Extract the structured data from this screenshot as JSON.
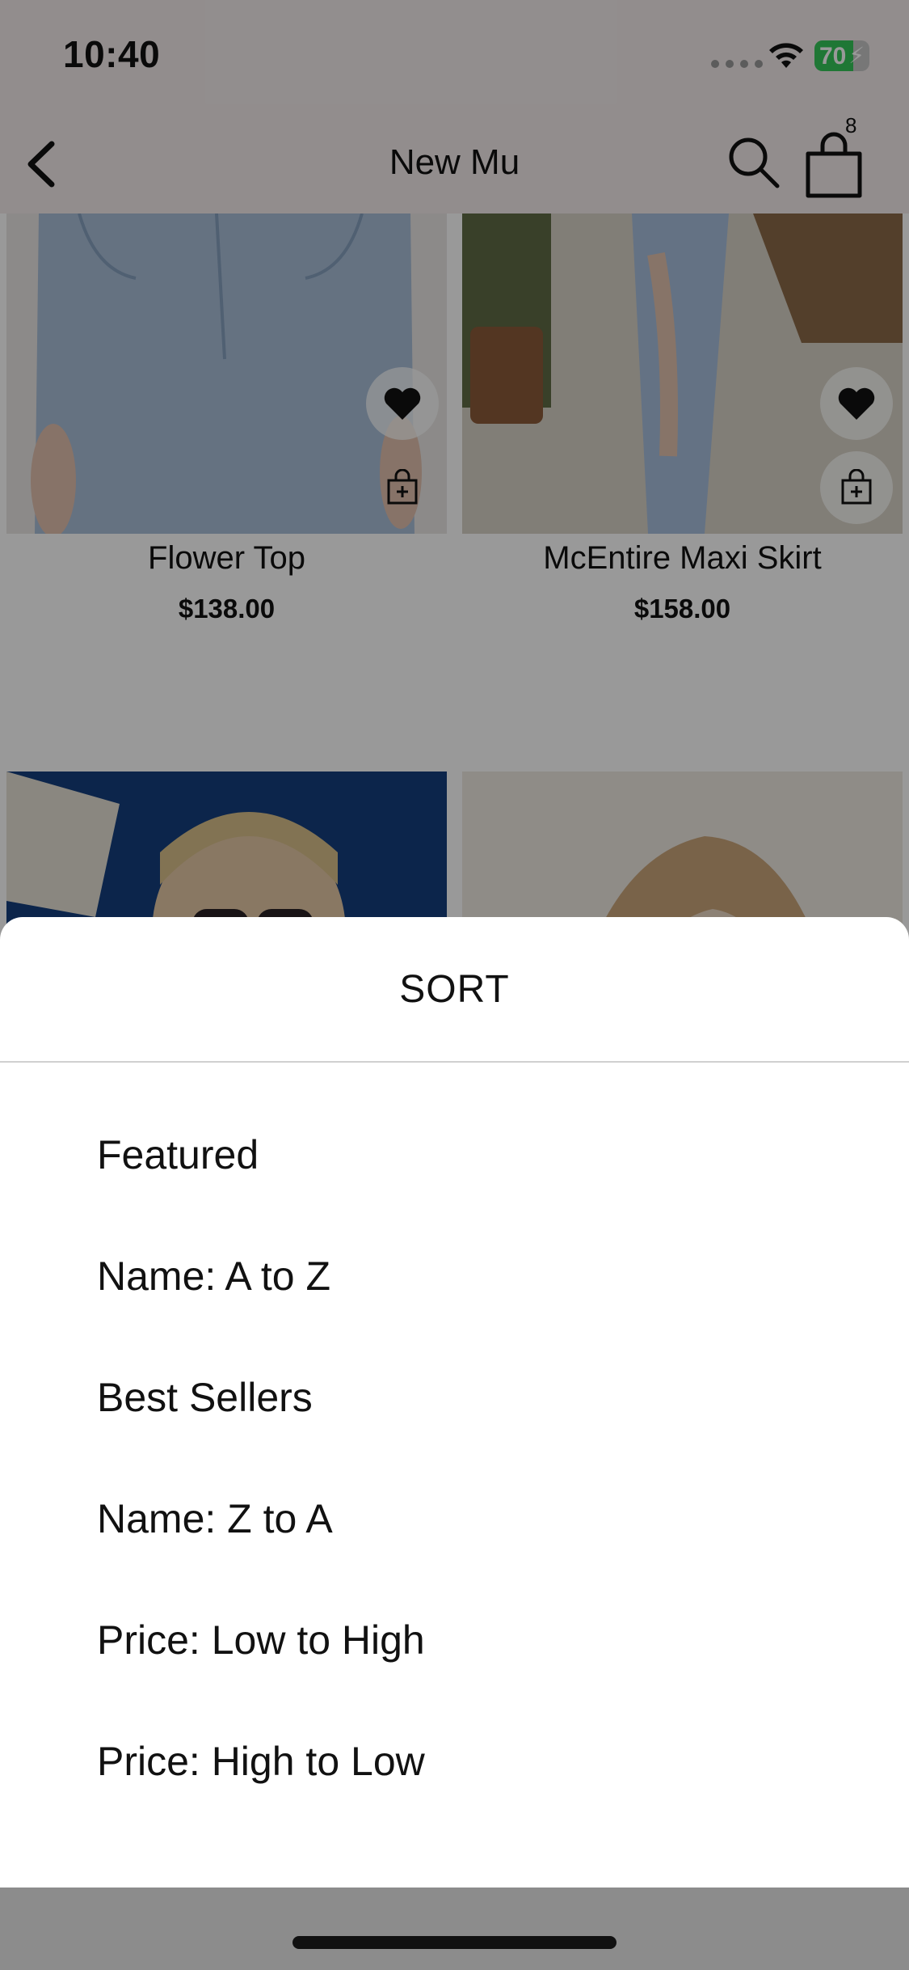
{
  "status_bar": {
    "time": "10:40",
    "battery_level": "70",
    "battery_fill_fraction": 0.7
  },
  "nav": {
    "title": "New Mu",
    "cart_count": "8"
  },
  "products": [
    {
      "name": "Flower Top",
      "price": "$138.00"
    },
    {
      "name": "McEntire Maxi Skirt",
      "price": "$158.00"
    }
  ],
  "sort_sheet": {
    "title": "SORT",
    "options": [
      "Featured",
      "Name: A to Z",
      "Best Sellers",
      "Name: Z to A",
      "Price: Low to High",
      "Price: High to Low"
    ]
  },
  "colors": {
    "header_bg": "#f3ecec",
    "battery_green": "#34c759",
    "overlay": "rgba(0,0,0,0.40)"
  },
  "icons": [
    "back-chevron-icon",
    "search-icon",
    "shopping-bag-icon",
    "heart-icon",
    "add-to-bag-icon",
    "wifi-icon",
    "battery-icon"
  ]
}
